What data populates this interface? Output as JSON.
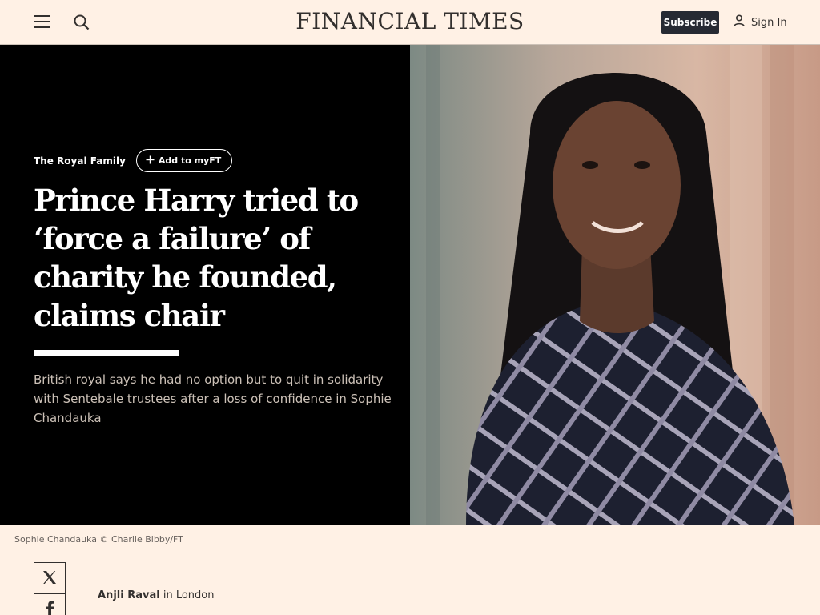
{
  "header": {
    "logo": "FINANCIAL TIMES",
    "subscribe_label": "Subscribe",
    "signin_label": "Sign In",
    "icons": [
      "menu-icon",
      "search-icon",
      "user-icon"
    ]
  },
  "article": {
    "topic": "The Royal Family",
    "myft_label": "Add to myFT",
    "headline": "Prince Harry tried to ‘force a failure’ of charity he founded, claims chair",
    "standfirst": "British royal says he had no option but to quit in solidarity with Sentebale trustees after a loss of confidence in Sophie Chandauka",
    "image_caption": "Sophie Chandauka © Charlie Bibby/FT",
    "author": "Anjli Raval",
    "location": "in London"
  },
  "share": [
    "x-icon",
    "facebook-icon"
  ],
  "colors": {
    "page_background": "#fff1e5",
    "hero_background": "#000000",
    "subscribe_background": "#262a33",
    "text": "#33302e"
  }
}
